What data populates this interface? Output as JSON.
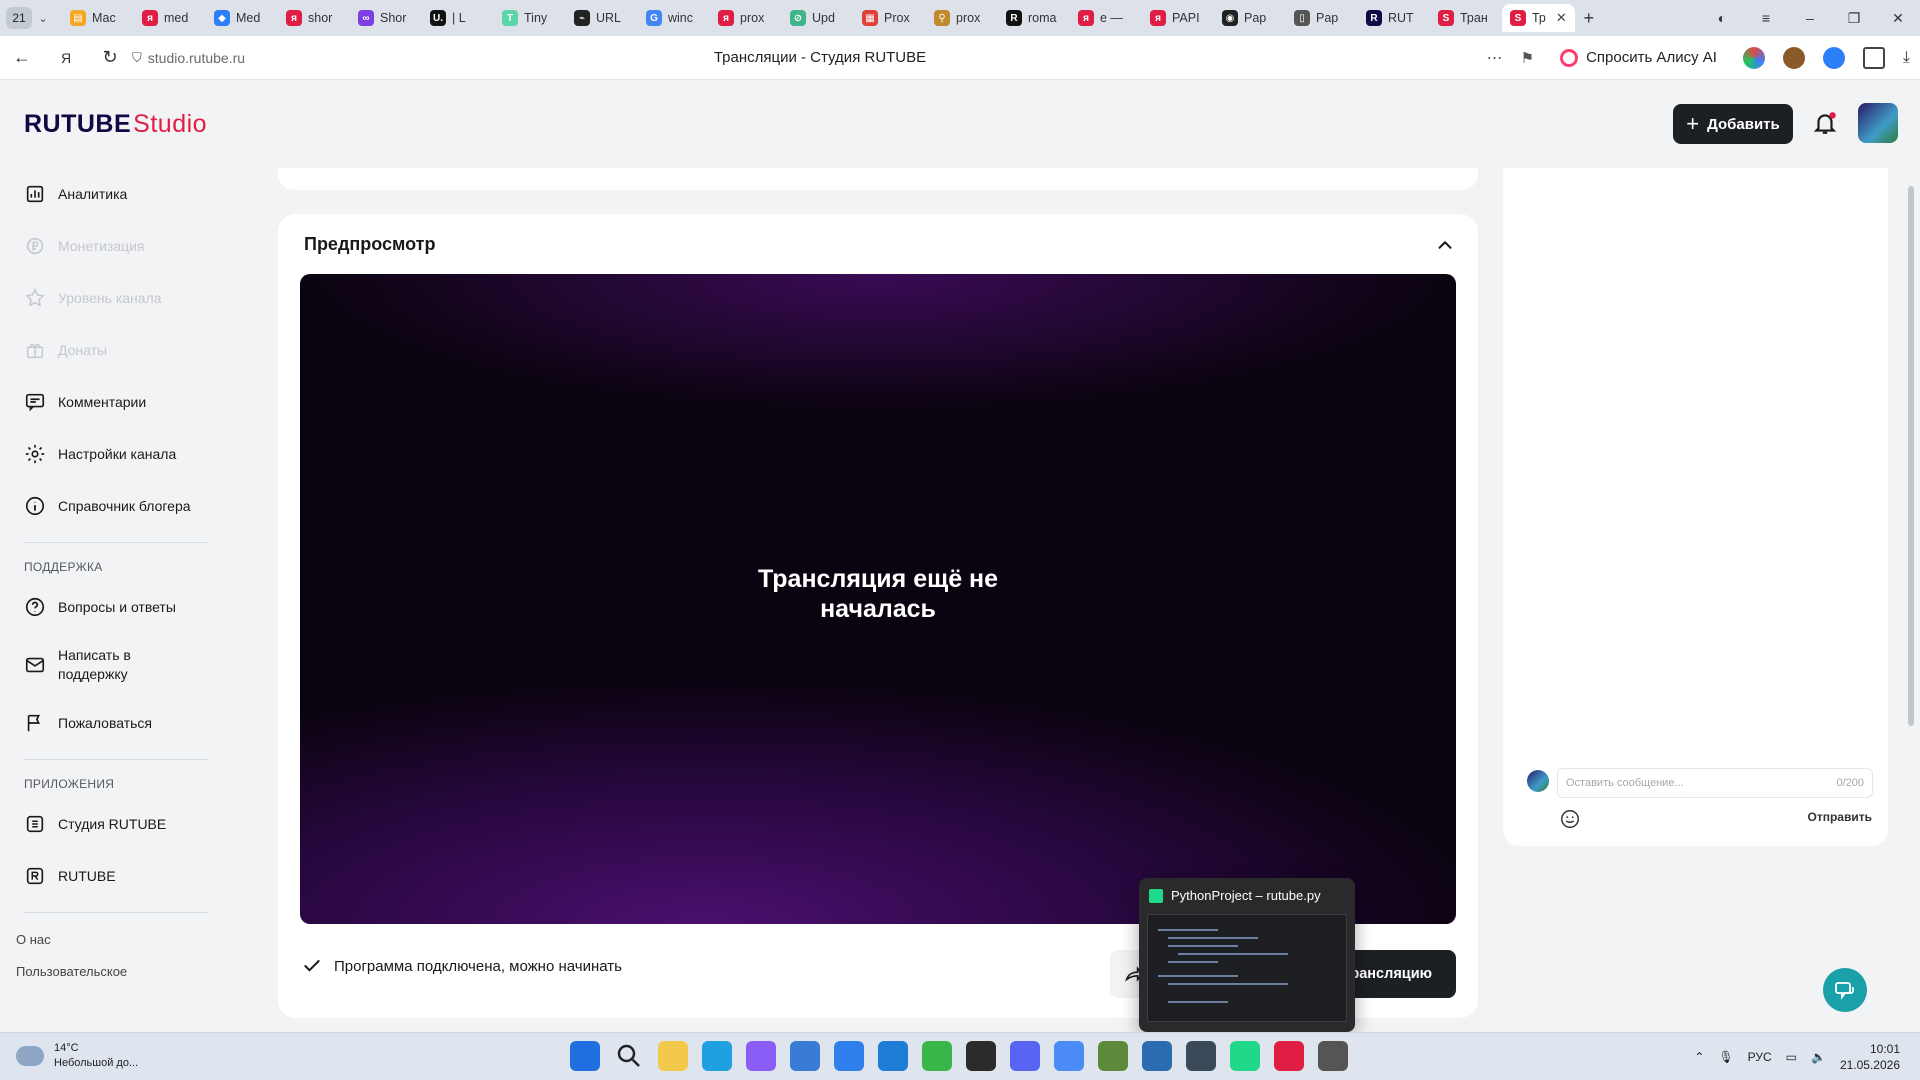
{
  "browser": {
    "tab_count": "21",
    "tabs": [
      {
        "label": "Мас",
        "color": "#f5a623",
        "glyph": "▤"
      },
      {
        "label": "med",
        "color": "#e01e44",
        "glyph": "я"
      },
      {
        "label": "Med",
        "color": "#2d7ff9",
        "glyph": "◆"
      },
      {
        "label": "shor",
        "color": "#e01e44",
        "glyph": "я"
      },
      {
        "label": "Shor",
        "color": "#7b3fe4",
        "glyph": "∞"
      },
      {
        "label": "| L",
        "color": "#111111",
        "glyph": "U."
      },
      {
        "label": "Tiny",
        "color": "#5bd5a8",
        "glyph": "T"
      },
      {
        "label": "URL",
        "color": "#222222",
        "glyph": "⌁"
      },
      {
        "label": "winc",
        "color": "#4285f4",
        "glyph": "G"
      },
      {
        "label": "prox",
        "color": "#e01e44",
        "glyph": "я"
      },
      {
        "label": "Upd",
        "color": "#3eb489",
        "glyph": "⊘"
      },
      {
        "label": "Prox",
        "color": "#e0403a",
        "glyph": "▦"
      },
      {
        "label": "prox",
        "color": "#c08a2d",
        "glyph": "⚲"
      },
      {
        "label": "roma",
        "color": "#111111",
        "glyph": "R"
      },
      {
        "label": "e —",
        "color": "#e01e44",
        "glyph": "я"
      },
      {
        "label": "PAPI",
        "color": "#e01e44",
        "glyph": "я"
      },
      {
        "label": "Pap",
        "color": "#222222",
        "glyph": "◉"
      },
      {
        "label": "Pap",
        "color": "#555555",
        "glyph": "▯"
      },
      {
        "label": "RUT",
        "color": "#100943",
        "glyph": "R"
      },
      {
        "label": "Тран",
        "color": "#e01e44",
        "glyph": "S"
      },
      {
        "label": "Тр",
        "color": "#e01e44",
        "glyph": "S",
        "active": true
      }
    ],
    "new_tab": "+",
    "url": "studio.rutube.ru",
    "page_title": "Трансляции - Студия RUTUBE",
    "alice_label": "Спросить Алису AI"
  },
  "header": {
    "logo_main": "RUTUBE",
    "logo_suffix": "Studio",
    "add_button": "Добавить"
  },
  "sidebar": {
    "items": [
      {
        "label": "Аналитика",
        "icon": "chart-icon",
        "disabled": false
      },
      {
        "label": "Монетизация",
        "icon": "coin-icon",
        "disabled": true
      },
      {
        "label": "Уровень канала",
        "icon": "star-icon",
        "disabled": true
      },
      {
        "label": "Донаты",
        "icon": "gift-icon",
        "disabled": true
      },
      {
        "label": "Комментарии",
        "icon": "comment-icon",
        "disabled": false
      },
      {
        "label": "Настройки канала",
        "icon": "gear-icon",
        "disabled": false
      },
      {
        "label": "Справочник блогера",
        "icon": "info-icon",
        "disabled": false
      }
    ],
    "support_heading": "ПОДДЕРЖКА",
    "support_items": [
      {
        "label": "Вопросы и ответы",
        "icon": "question-icon"
      },
      {
        "label": "Написать в поддержку",
        "icon": "mail-icon"
      },
      {
        "label": "Пожаловаться",
        "icon": "flag-icon"
      }
    ],
    "apps_heading": "ПРИЛОЖЕНИЯ",
    "apps_items": [
      {
        "label": "Студия RUTUBE",
        "icon": "studio-icon"
      },
      {
        "label": "RUTUBE",
        "icon": "rutube-icon"
      }
    ],
    "footer_links": [
      "О нас",
      "Пользовательское"
    ]
  },
  "preview": {
    "title": "Предпросмотр",
    "player_message_line1": "Трансляция ещё не",
    "player_message_line2": "началась",
    "status": "Программа подключена, можно начинать",
    "start_button": "рансляцию"
  },
  "chat": {
    "placeholder": "Оставить сообщение...",
    "counter": "0/200",
    "send": "Отправить"
  },
  "taskbar_preview": {
    "title": "PythonProject – rutube.py"
  },
  "taskbar": {
    "weather_temp": "14°C",
    "weather_desc": "Небольшой до...",
    "apps": [
      {
        "name": "windows-start-icon",
        "color": "#1f6fe0"
      },
      {
        "name": "search-icon",
        "color": "#dfe5ee"
      },
      {
        "name": "file-explorer-icon",
        "color": "#f2c94c"
      },
      {
        "name": "edge-icon",
        "color": "#1fa0e0"
      },
      {
        "name": "m365-icon",
        "color": "#8a5cf6"
      },
      {
        "name": "store-icon",
        "color": "#3a7bd5"
      },
      {
        "name": "mail-app-icon",
        "color": "#2f80ed"
      },
      {
        "name": "vscode-icon",
        "color": "#1c7cd6"
      },
      {
        "name": "torrent-icon",
        "color": "#3ab54a"
      },
      {
        "name": "terminal-icon",
        "color": "#2b2b2b"
      },
      {
        "name": "discord-icon",
        "color": "#5865f2"
      },
      {
        "name": "chrome-icon",
        "color": "#4a8bf5"
      },
      {
        "name": "minecraft-icon",
        "color": "#5c8a3a"
      },
      {
        "name": "vs-icon",
        "color": "#2b6cb0"
      },
      {
        "name": "app-icon",
        "color": "#3b4a5a"
      },
      {
        "name": "pycharm-icon",
        "color": "#21d789"
      },
      {
        "name": "yandex-browser-icon",
        "color": "#e01e44"
      },
      {
        "name": "chatgpt-icon",
        "color": "#555555"
      }
    ],
    "lang": "РУС",
    "time": "10:01",
    "date": "21.05.2026"
  }
}
